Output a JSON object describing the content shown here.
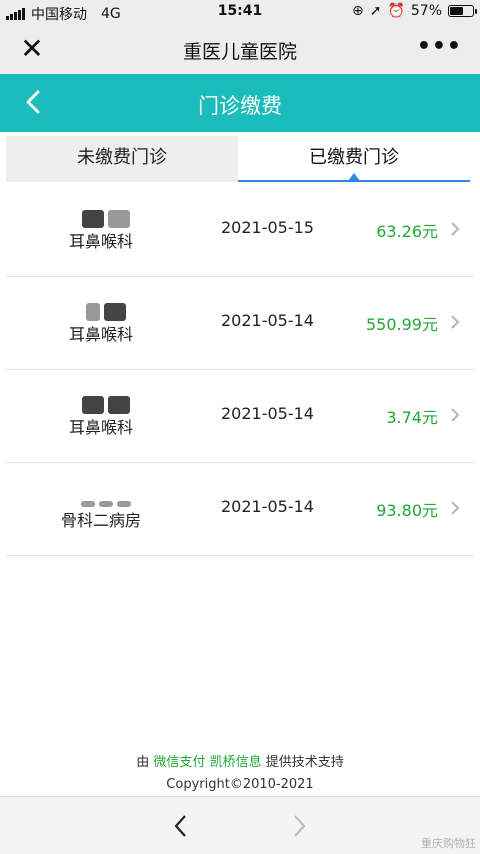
{
  "status_bar": {
    "carrier": "中国移动",
    "network": "4G",
    "time": "15:41",
    "battery_percent": "57%",
    "battery_level": 0.57
  },
  "wechat_header": {
    "close_icon": "close-icon",
    "title": "重医儿童医院",
    "more_icon": "more-icon"
  },
  "page_header": {
    "title": "门诊缴费",
    "back_icon": "chevron-left-icon"
  },
  "tabs": [
    {
      "label": "未缴费门诊",
      "active": false
    },
    {
      "label": "已缴费门诊",
      "active": true
    }
  ],
  "payments": [
    {
      "department": "耳鼻喉科",
      "date": "2021-05-15",
      "amount": "63.26元"
    },
    {
      "department": "耳鼻喉科",
      "date": "2021-05-14",
      "amount": "550.99元"
    },
    {
      "department": "耳鼻喉科",
      "date": "2021-05-14",
      "amount": "3.74元"
    },
    {
      "department": "骨科二病房",
      "date": "2021-05-14",
      "amount": "93.80元"
    }
  ],
  "footer": {
    "prefix": "由",
    "provider1": "微信支付",
    "provider2": "凯桥信息",
    "suffix": "提供技术支持",
    "copyright": "Copyright©2010-2021"
  },
  "bottom_bar": {
    "back_icon": "chevron-left-icon",
    "forward_icon": "chevron-right-icon",
    "watermark": "重庆购物狂"
  },
  "colors": {
    "header_bg": "#1bbcbc",
    "amount": "#23a736",
    "tab_underline": "#2d8ae0"
  }
}
